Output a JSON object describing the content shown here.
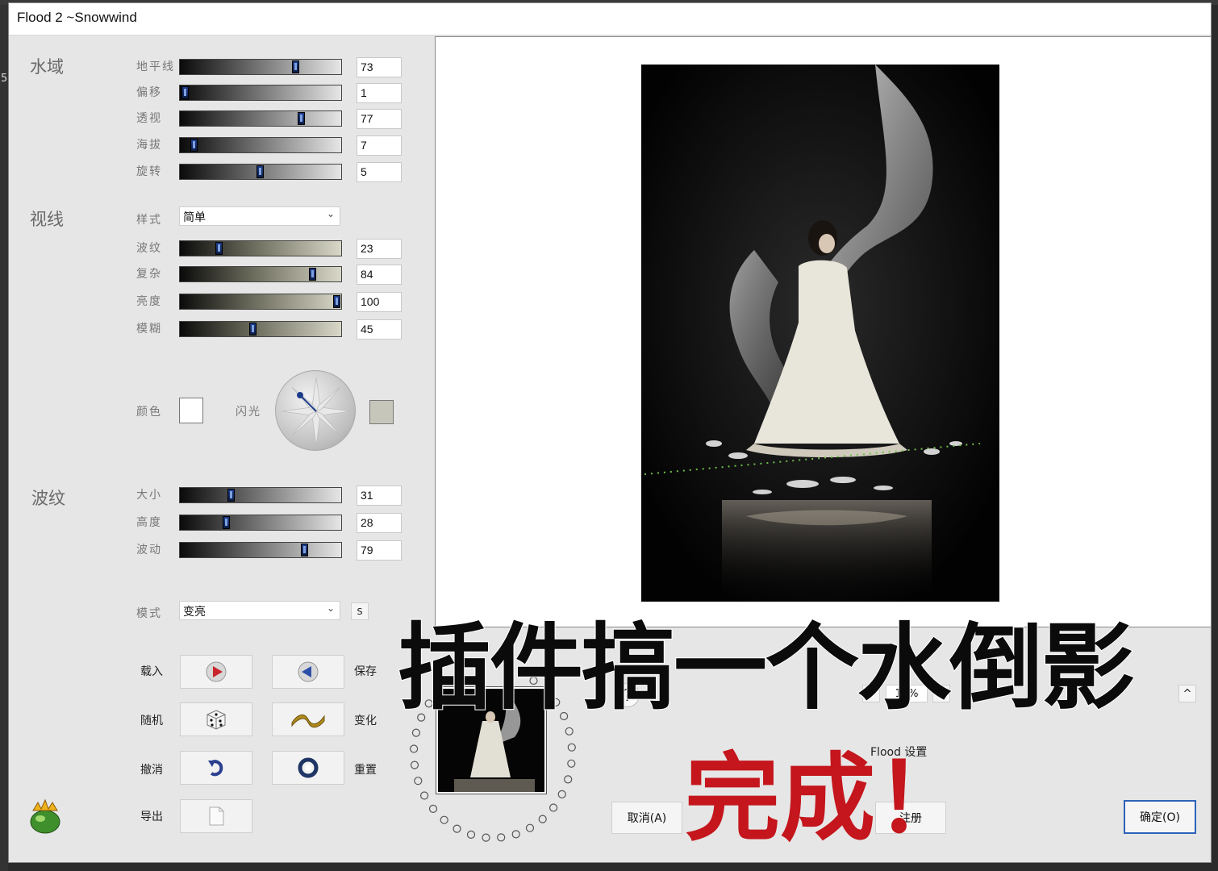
{
  "window": {
    "title": "Flood 2 ~Snowwind"
  },
  "side": {
    "digit": "5"
  },
  "sections": {
    "water": "水域",
    "sight": "视线",
    "ripple": "波纹"
  },
  "water_rows": [
    {
      "label": "地平线",
      "value": "73",
      "level": 0.73
    },
    {
      "label": "偏移",
      "value": "1",
      "level": 0.01
    },
    {
      "label": "透视",
      "value": "77",
      "level": 0.77
    },
    {
      "label": "海拔",
      "value": "7",
      "level": 0.07
    },
    {
      "label": "旋转",
      "value": "5",
      "level": 0.5
    }
  ],
  "sight": {
    "style_label": "样式",
    "style_value": "简单",
    "rows": [
      {
        "label": "波纹",
        "value": "23",
        "level": 0.23
      },
      {
        "label": "复杂",
        "value": "84",
        "level": 0.84
      },
      {
        "label": "亮度",
        "value": "100",
        "level": 1.0
      },
      {
        "label": "模糊",
        "value": "45",
        "level": 0.45
      }
    ],
    "color_label": "颜色",
    "flash_label": "闪光"
  },
  "ripple_rows": [
    {
      "label": "大小",
      "value": "31",
      "level": 0.31
    },
    {
      "label": "高度",
      "value": "28",
      "level": 0.28
    },
    {
      "label": "波动",
      "value": "79",
      "level": 0.79
    }
  ],
  "mode": {
    "label": "模式",
    "value": "变亮",
    "s_label": "S"
  },
  "actions": {
    "load": "载入",
    "save": "保存",
    "random": "随机",
    "change": "变化",
    "undo": "撤消",
    "reset": "重置",
    "export": "导出"
  },
  "zoom": {
    "minus": "−",
    "value": "10%",
    "plus": "+"
  },
  "help": "?",
  "caret": "^",
  "flood_settings": "Flood 设置",
  "buttons": {
    "cancel": "取消(A)",
    "register": "注册",
    "ok": "确定(O)"
  },
  "overlay": {
    "headline": "插件搞一个水倒影",
    "done": "完成！"
  },
  "colors": {
    "color_swatch": "#ffffff",
    "flash_swatch": "#c6c6bb",
    "accent": "#2d63b8",
    "done_red": "#c4161c"
  }
}
